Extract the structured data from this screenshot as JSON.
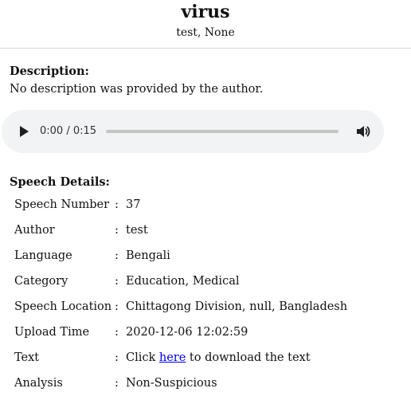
{
  "header": {
    "title": "virus",
    "subtitle": "test, None"
  },
  "description": {
    "heading": "Description:",
    "text": "No description was provided by the author."
  },
  "audio": {
    "time": "0:00 / 0:15",
    "progress": 0
  },
  "details": {
    "heading": "Speech Details:",
    "separator": ":",
    "rows": [
      {
        "label": "Speech Number",
        "value": "37"
      },
      {
        "label": "Author",
        "value": "test"
      },
      {
        "label": "Language",
        "value": "Bengali"
      },
      {
        "label": "Category",
        "value": "Education, Medical"
      },
      {
        "label": "Speech Location",
        "value": "Chittagong Division, null, Bangladesh"
      },
      {
        "label": "Upload Time",
        "value": "2020-12-06 12:02:59"
      },
      {
        "label": "Text",
        "value_prefix": "Click ",
        "link_text": "here",
        "value_suffix": " to download the text"
      },
      {
        "label": "Analysis",
        "value": "Non-Suspicious"
      }
    ]
  },
  "colors": {
    "link": "#0000ee",
    "player_background": "#f1f3f4"
  }
}
